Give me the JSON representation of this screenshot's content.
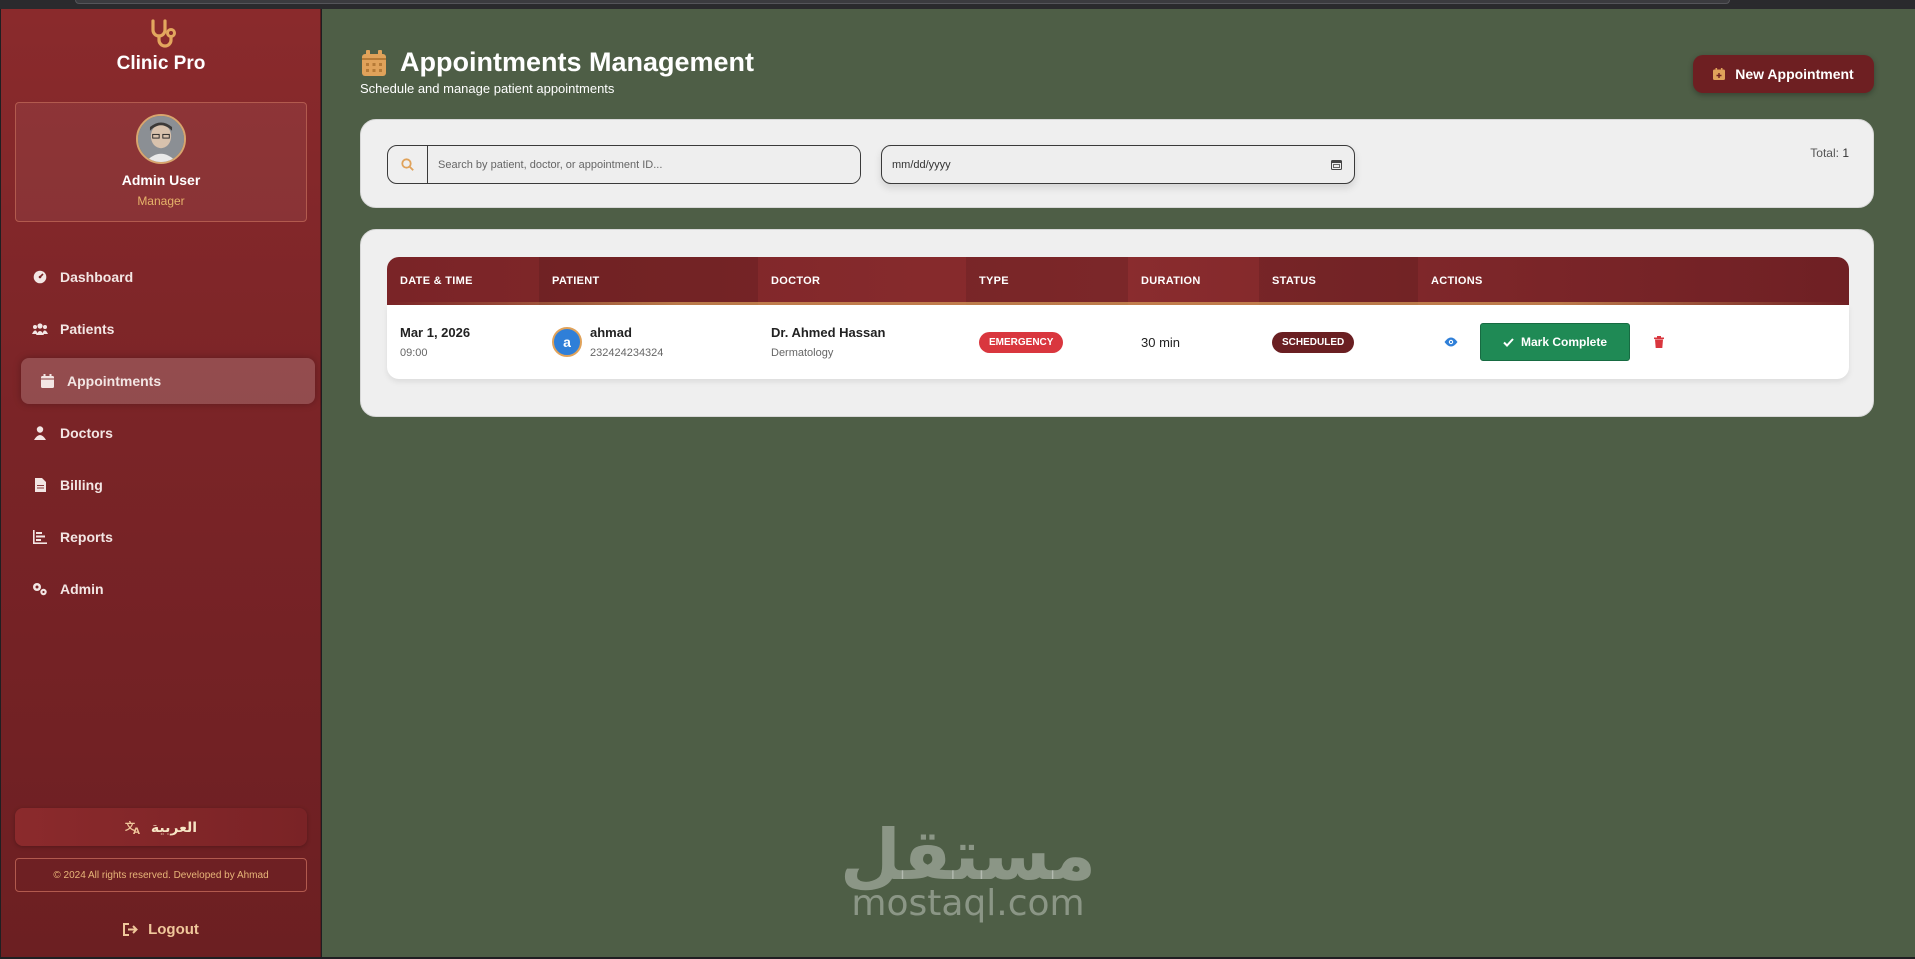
{
  "brand": {
    "name": "Clinic Pro"
  },
  "user": {
    "name": "Admin User",
    "role": "Manager"
  },
  "nav": [
    {
      "label": "Dashboard",
      "icon": "dashboard-icon"
    },
    {
      "label": "Patients",
      "icon": "patients-icon"
    },
    {
      "label": "Appointments",
      "icon": "calendar-icon",
      "active": true
    },
    {
      "label": "Doctors",
      "icon": "doctor-icon"
    },
    {
      "label": "Billing",
      "icon": "invoice-icon"
    },
    {
      "label": "Reports",
      "icon": "chart-icon"
    },
    {
      "label": "Admin",
      "icon": "cogs-icon"
    }
  ],
  "language_button": "العربية",
  "copyright": "© 2024 All rights reserved. Developed by Ahmad",
  "logout": "Logout",
  "page": {
    "title": "Appointments Management",
    "subtitle": "Schedule and manage patient appointments",
    "new_button": "New Appointment"
  },
  "filters": {
    "search_placeholder": "Search by patient, doctor, or appointment ID...",
    "date_placeholder": "mm/dd/yyyy",
    "total_label": "Total:",
    "total_value": "1"
  },
  "table": {
    "headers": [
      "DATE & TIME",
      "PATIENT",
      "DOCTOR",
      "TYPE",
      "DURATION",
      "STATUS",
      "ACTIONS"
    ],
    "rows": [
      {
        "date": "Mar 1, 2026",
        "time": "09:00",
        "patient_initial": "a",
        "patient_name": "ahmad",
        "patient_phone": "232424234324",
        "doctor_name": "Dr. Ahmed Hassan",
        "doctor_specialty": "Dermatology",
        "type": "EMERGENCY",
        "duration": "30 min",
        "status": "SCHEDULED",
        "complete_label": "Mark Complete"
      }
    ]
  },
  "watermark": {
    "arabic": "مستقل",
    "latin": "mostaql.com"
  },
  "colors": {
    "sidebar": "#7a2427",
    "main_bg": "#4e5e46",
    "accent_gold": "#e0a25a",
    "emergency": "#d9363e",
    "complete_green": "#1f8a55"
  }
}
